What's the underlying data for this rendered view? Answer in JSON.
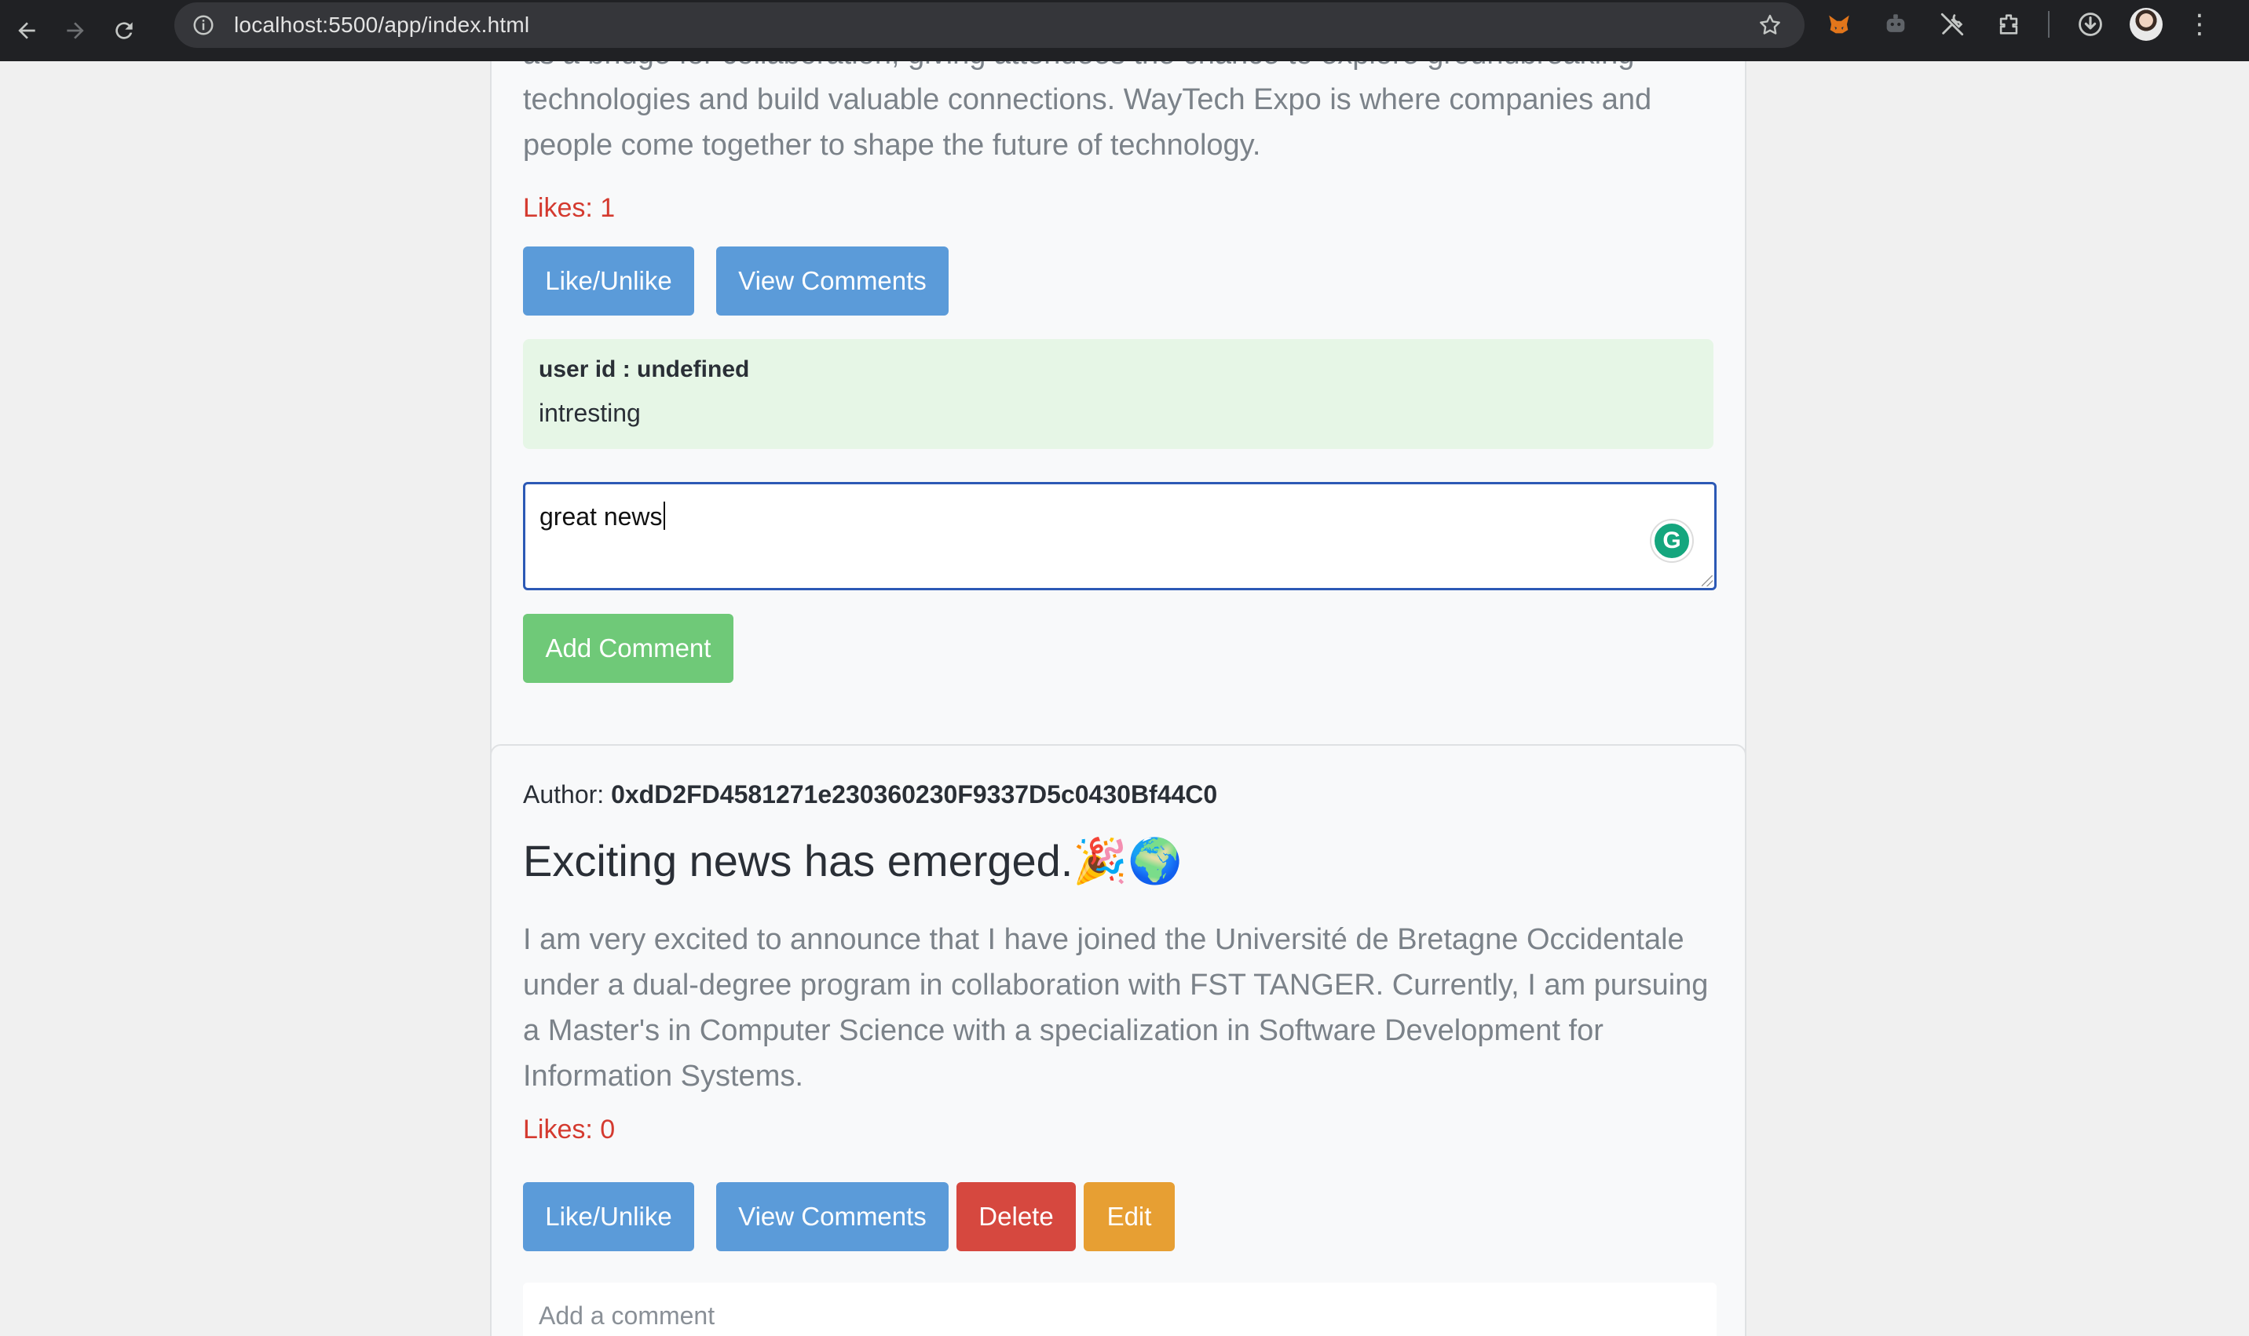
{
  "browser": {
    "url": "localhost:5500/app/index.html"
  },
  "posts": [
    {
      "description_partial": "as a bridge for collaboration, giving attendees the chance to explore groundbreaking technologies and build valuable connections. WayTech Expo is where companies and people come together to shape the future of technology.",
      "likes": "Likes: 1",
      "like_label": "Like/Unlike",
      "view_comments_label": "View Comments",
      "comments": [
        {
          "user": "user id : undefined",
          "text": "intresting"
        }
      ],
      "comment_input_value": "great news",
      "add_comment_label": "Add Comment"
    },
    {
      "author_label": "Author:",
      "author": "0xdD2FD4581271e230360230F9337D5c0430Bf44C0",
      "title": "Exciting news has emerged.🎉🌍",
      "description": "I am very excited to announce that I have joined the Université de Bretagne Occidentale under a dual-degree program in collaboration with FST TANGER. Currently, I am pursuing a Master's in Computer Science with a specialization in Software Development for Information Systems.",
      "likes": "Likes: 0",
      "like_label": "Like/Unlike",
      "view_comments_label": "View Comments",
      "delete_label": "Delete",
      "edit_label": "Edit",
      "comment_placeholder": "Add a comment"
    }
  ]
}
